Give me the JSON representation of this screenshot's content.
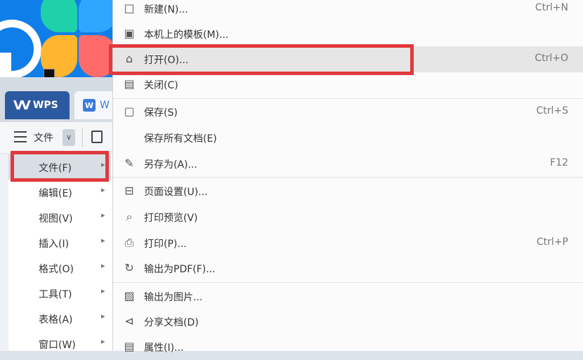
{
  "tabs": {
    "wps": "WPS",
    "doc_logo": "W",
    "doc": "W"
  },
  "toolbar": {
    "file_menu": "文件"
  },
  "left_menu": [
    {
      "label": "文件(F)",
      "active": true
    },
    {
      "label": "编辑(E)"
    },
    {
      "label": "视图(V)"
    },
    {
      "label": "插入(I)"
    },
    {
      "label": "格式(O)"
    },
    {
      "label": "工具(T)"
    },
    {
      "label": "表格(A)"
    },
    {
      "label": "窗口(W)"
    }
  ],
  "submenu": [
    {
      "label": "新建(N)...",
      "shortcut": "Ctrl+N",
      "icon": "new-document-icon"
    },
    {
      "label": "本机上的模板(M)...",
      "shortcut": "",
      "icon": "template-icon"
    },
    {
      "label": "打开(O)...",
      "shortcut": "Ctrl+O",
      "icon": "folder-open-icon"
    },
    {
      "label": "关闭(C)",
      "shortcut": "",
      "icon": "close-document-icon"
    },
    {
      "label": "保存(S)",
      "shortcut": "Ctrl+S",
      "icon": "save-icon"
    },
    {
      "label": "保存所有文档(E)",
      "shortcut": "",
      "icon": ""
    },
    {
      "label": "另存为(A)...",
      "shortcut": "F12",
      "icon": "save-as-icon"
    },
    {
      "label": "页面设置(U)...",
      "shortcut": "",
      "icon": "page-setup-icon"
    },
    {
      "label": "打印预览(V)",
      "shortcut": "",
      "icon": "print-preview-icon"
    },
    {
      "label": "打印(P)...",
      "shortcut": "Ctrl+P",
      "icon": "printer-icon"
    },
    {
      "label": "输出为PDF(F)...",
      "shortcut": "",
      "icon": "export-pdf-icon"
    },
    {
      "label": "输出为图片...",
      "shortcut": "",
      "icon": "export-image-icon"
    },
    {
      "label": "分享文档(D)",
      "shortcut": "",
      "icon": "share-icon"
    },
    {
      "label": "属性(I)...",
      "shortcut": "",
      "icon": "properties-icon"
    }
  ],
  "colors": {
    "highlight": "#e0393e",
    "wps_tab": "#2c5aa0",
    "desktop": "#0f7ee8"
  }
}
